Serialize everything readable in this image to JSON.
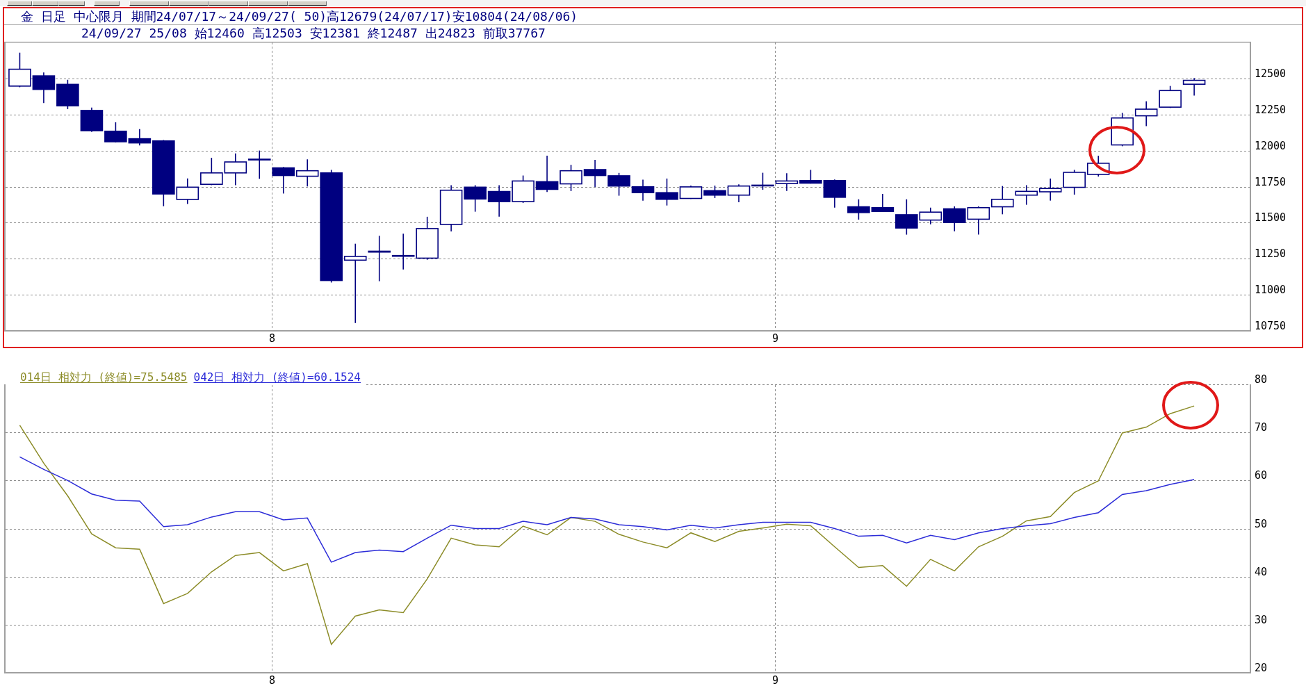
{
  "toolbar": {
    "buttons": [
      {
        "kind": "button"
      },
      {
        "kind": "button"
      },
      {
        "kind": "button"
      },
      {
        "kind": "button"
      },
      {
        "kind": "button"
      },
      {
        "kind": "button"
      },
      {
        "kind": "button"
      },
      {
        "kind": "button"
      },
      {
        "kind": "button"
      }
    ]
  },
  "price_panel": {
    "header_lines": [
      "金 日足 中心限月 期間24/07/17～24/09/27( 50)高12679(24/07/17)安10804(24/08/06)",
      "24/09/27 25/08 始12460 高12503 安12381 終12487 出24823 前取37767"
    ],
    "chart_data": {
      "type": "candlestick",
      "grid": true,
      "x": [
        7.5,
        7.5476,
        7.5952,
        7.6429,
        7.6905,
        7.7381,
        7.7857,
        7.8333,
        7.881,
        7.9286,
        7.9762,
        8.0238,
        8.0714,
        8.119,
        8.1667,
        8.2143,
        8.2619,
        8.3095,
        8.3571,
        8.4048,
        8.4524,
        8.5,
        8.5476,
        8.5952,
        8.6429,
        8.6905,
        8.7381,
        8.7857,
        8.8333,
        8.881,
        8.9286,
        8.9762,
        9.0238,
        9.0714,
        9.119,
        9.1667,
        9.2143,
        9.2619,
        9.3095,
        9.3571,
        9.4048,
        9.4524,
        9.5,
        9.5476,
        9.5952,
        9.6429,
        9.6905,
        9.7381,
        9.7857,
        9.8333
      ],
      "xlim": [
        7.469,
        9.945
      ],
      "ylim": [
        10750,
        12750
      ],
      "xticks": [
        8,
        9
      ],
      "yticks": [
        10750,
        11000,
        11250,
        11500,
        11750,
        12000,
        12250,
        12500
      ],
      "series": [
        {
          "ohlc": [
            [
              12447,
              12679,
              12439,
              12564
            ],
            [
              12518,
              12541,
              12330,
              12424
            ],
            [
              12459,
              12491,
              12287,
              12310
            ],
            [
              12278,
              12298,
              12130,
              12137
            ],
            [
              12134,
              12196,
              12056,
              12061
            ],
            [
              12082,
              12149,
              12035,
              12053
            ],
            [
              12067,
              12073,
              11614,
              11699
            ],
            [
              11661,
              11807,
              11629,
              11746
            ],
            [
              11766,
              11950,
              11760,
              11845
            ],
            [
              11845,
              11980,
              11760,
              11921
            ],
            [
              11936,
              12000,
              11804,
              11940
            ],
            [
              11880,
              11886,
              11702,
              11827
            ],
            [
              11822,
              11939,
              11751,
              11860
            ],
            [
              11845,
              11866,
              11085,
              11099
            ],
            [
              11240,
              11354,
              10804,
              11266
            ],
            [
              11302,
              11409,
              11094,
              11296
            ],
            [
              11272,
              11424,
              11175,
              11268
            ],
            [
              11254,
              11541,
              11243,
              11459
            ],
            [
              11488,
              11760,
              11439,
              11725
            ],
            [
              11746,
              11760,
              11576,
              11664
            ],
            [
              11716,
              11760,
              11541,
              11646
            ],
            [
              11646,
              11827,
              11637,
              11789
            ],
            [
              11784,
              11965,
              11713,
              11731
            ],
            [
              11769,
              11901,
              11719,
              11860
            ],
            [
              11868,
              11936,
              11746,
              11827
            ],
            [
              11825,
              11845,
              11687,
              11754
            ],
            [
              11749,
              11798,
              11652,
              11708
            ],
            [
              11708,
              11806,
              11619,
              11662
            ],
            [
              11668,
              11757,
              11665,
              11748
            ],
            [
              11722,
              11757,
              11671,
              11691
            ],
            [
              11691,
              11766,
              11642,
              11754
            ],
            [
              11758,
              11846,
              11728,
              11760
            ],
            [
              11771,
              11843,
              11720,
              11789
            ],
            [
              11792,
              11866,
              11771,
              11774
            ],
            [
              11792,
              11800,
              11604,
              11676
            ],
            [
              11610,
              11662,
              11521,
              11570
            ],
            [
              11604,
              11699,
              11575,
              11578
            ],
            [
              11555,
              11662,
              11417,
              11463
            ],
            [
              11518,
              11604,
              11489,
              11573
            ],
            [
              11596,
              11613,
              11440,
              11501
            ],
            [
              11524,
              11613,
              11417,
              11604
            ],
            [
              11610,
              11754,
              11558,
              11662
            ],
            [
              11691,
              11760,
              11624,
              11717
            ],
            [
              11714,
              11806,
              11653,
              11737
            ],
            [
              11745,
              11866,
              11694,
              11849
            ],
            [
              11835,
              11964,
              11820,
              11912
            ],
            [
              12039,
              12261,
              12030,
              12226
            ],
            [
              12241,
              12342,
              12169,
              12287
            ],
            [
              12301,
              12448,
              12295,
              12416
            ],
            [
              12460,
              12503,
              12381,
              12487
            ]
          ]
        }
      ]
    }
  },
  "rsi_panel": {
    "chart_data": {
      "type": "line",
      "grid": true,
      "x": [
        7.5,
        7.5476,
        7.5952,
        7.6429,
        7.6905,
        7.7381,
        7.7857,
        7.8333,
        7.881,
        7.9286,
        7.9762,
        8.0238,
        8.0714,
        8.119,
        8.1667,
        8.2143,
        8.2619,
        8.3095,
        8.3571,
        8.4048,
        8.4524,
        8.5,
        8.5476,
        8.5952,
        8.6429,
        8.6905,
        8.7381,
        8.7857,
        8.8333,
        8.881,
        8.9286,
        8.9762,
        9.0238,
        9.0714,
        9.119,
        9.1667,
        9.2143,
        9.2619,
        9.3095,
        9.3571,
        9.4048,
        9.4524,
        9.5,
        9.5476,
        9.5952,
        9.6429,
        9.6905,
        9.7381,
        9.7857,
        9.8333
      ],
      "xlim": [
        7.469,
        9.945
      ],
      "ylim": [
        20,
        80
      ],
      "xticks": [
        8,
        9
      ],
      "yticks": [
        20,
        30,
        40,
        50,
        60,
        70,
        80
      ],
      "series": [
        {
          "name": "014日 相対力 (終値)=75.5485",
          "color": "#8c8c28",
          "values": [
            71.5,
            63.6,
            56.8,
            48.9,
            46.0,
            45.7,
            34.4,
            36.5,
            41.0,
            44.4,
            45.0,
            41.2,
            42.7,
            25.9,
            31.8,
            33.1,
            32.5,
            39.5,
            48.0,
            46.6,
            46.2,
            50.5,
            48.7,
            52.3,
            51.5,
            48.8,
            47.2,
            46.0,
            49.1,
            47.3,
            49.4,
            50.1,
            50.9,
            50.6,
            46.2,
            41.9,
            42.3,
            38.0,
            43.6,
            41.2,
            46.2,
            48.4,
            51.6,
            52.5,
            57.5,
            59.9,
            69.9,
            71.1,
            73.9,
            75.5
          ]
        },
        {
          "name": "042日 相対力 (終値)=60.1524",
          "color": "#2c2cd8",
          "values": [
            64.9,
            62.3,
            60.0,
            57.2,
            55.9,
            55.7,
            50.4,
            50.8,
            52.4,
            53.5,
            53.5,
            51.8,
            52.2,
            43.0,
            45.0,
            45.5,
            45.2,
            48.0,
            50.7,
            50.0,
            50.0,
            51.5,
            50.8,
            52.3,
            52.0,
            50.8,
            50.4,
            49.7,
            50.7,
            50.1,
            50.8,
            51.3,
            51.3,
            51.3,
            50.0,
            48.4,
            48.6,
            47.0,
            48.6,
            47.7,
            49.1,
            50.0,
            50.6,
            51.0,
            52.3,
            53.3,
            57.1,
            57.9,
            59.2,
            60.2
          ]
        }
      ]
    }
  }
}
